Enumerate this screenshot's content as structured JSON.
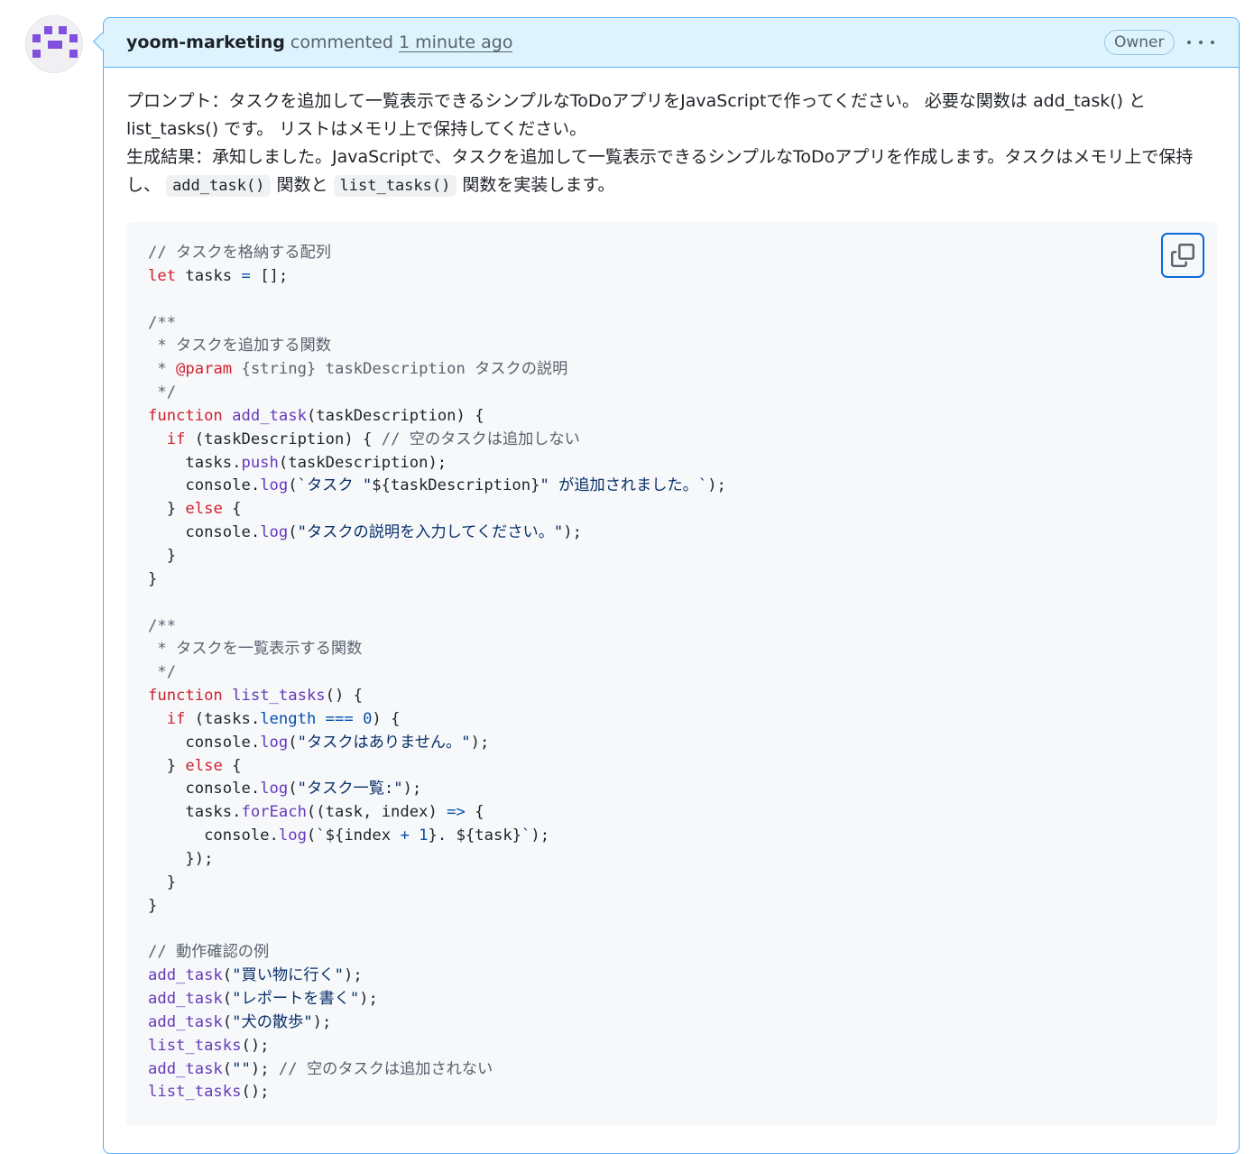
{
  "comment": {
    "author": "yoom-marketing",
    "action": "commented",
    "time": "1 minute ago",
    "badge": "Owner"
  },
  "prose": {
    "line1": "プロンプト：タスクを追加して一覧表示できるシンプルなToDoアプリをJavaScriptで作ってください。 必要な関数は add_task() と list_tasks() です。 リストはメモリ上で保持してください。",
    "line2_before": "生成結果：承知しました。JavaScriptで、タスクを追加して一覧表示できるシンプルなToDoアプリを作成します。タスクはメモリ上で保持し、",
    "code1": "add_task()",
    "mid": "関数と",
    "code2": "list_tasks()",
    "line2_after": "関数を実装します。"
  },
  "colors": {
    "header_bg": "#ddf4ff",
    "border": "#54aeff",
    "code_bg": "#f6f8fa",
    "keyword": "#cf222e",
    "function": "#6639ba",
    "string": "#0a3069",
    "number": "#0550ae",
    "avatar_purple": "#8250df"
  },
  "icons": {
    "avatar": "identicon-avatar",
    "menu": "kebab-horizontal-icon",
    "copy": "copy-icon"
  }
}
